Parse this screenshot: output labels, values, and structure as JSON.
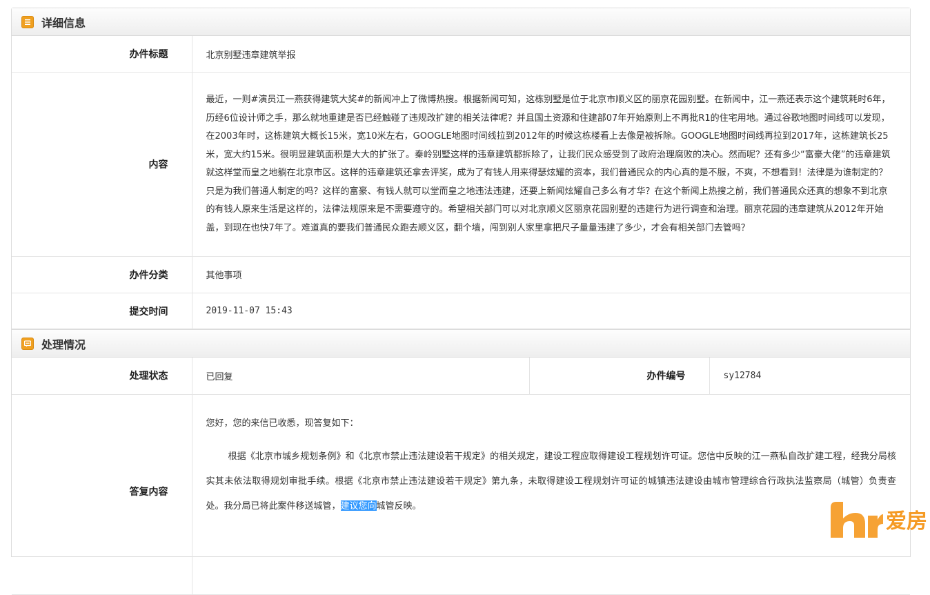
{
  "detail": {
    "header": "详细信息",
    "rows": {
      "title_label": "办件标题",
      "title_value": "北京别墅违章建筑举报",
      "content_label": "内容",
      "content_value": "最近，一则#演员江一燕获得建筑大奖#的新闻冲上了微博热搜。根据新闻可知，这栋别墅是位于北京市顺义区的丽京花园别墅。在新闻中，江一燕还表示这个建筑耗时6年，历经6位设计师之手，那么就地重建是否已经触碰了违规改扩建的相关法律呢？并且国土资源和住建部07年开始原则上不再批R1的住宅用地。通过谷歌地图时间线可以发现，在2003年时，这栋建筑大概长15米，宽10米左右，GOOGLE地图时间线拉到2012年的时候这栋楼看上去像是被拆除。GOOGLE地图时间线再拉到2017年，这栋建筑长25米，宽大约15米。很明显建筑面积是大大的扩张了。秦岭别墅这样的违章建筑都拆除了，让我们民众感受到了政府治理腐败的决心。然而呢？还有多少“富豪大佬”的违章建筑就这样堂而皇之地躺在北京市区。这样的违章建筑还拿去评奖，成为了有钱人用来得瑟炫耀的资本，我们普通民众的内心真的是不服，不爽，不想看到！法律是为谁制定的？只是为我们普通人制定的吗？这样的富豪、有钱人就可以堂而皇之地违法违建，还要上新闻炫耀自己多么有才华？在这个新闻上热搜之前，我们普通民众还真的想象不到北京的有钱人原来生活是这样的，法律法规原来是不需要遵守的。希望相关部门可以对北京顺义区丽京花园别墅的违建行为进行调查和治理。丽京花园的违章建筑从2012年开始盖，到现在也快7年了。难道真的要我们普通民众跑去顺义区，翻个墙，闯到别人家里拿把尺子量量违建了多少，才会有相关部门去管吗？",
      "category_label": "办件分类",
      "category_value": "其他事项",
      "time_label": "提交时间",
      "time_value": "2019-11-07 15:43"
    }
  },
  "processing": {
    "header": "处理情况",
    "status_label": "处理状态",
    "status_value": "已回复",
    "number_label": "办件编号",
    "number_value": "sy12784",
    "reply_label": "答复内容",
    "reply_greeting": "您好，您的来信已收悉，现答复如下：",
    "reply_body_main": "根据《北京市城乡规划条例》和《北京市禁止违法建设若干规定》的相关规定，建设工程应取得建设工程规划许可证。您信中反映的江一燕私自改扩建工程，经我分局核实其未依法取得规划审批手续。根据《北京市禁止违法建设若干规定》第九条，未取得建设工程规划许可证的城镇违法建设由城市管理综合行政执法监察局（城管）负责查处。我分局已将此案件移送城管，",
    "reply_body_selected": "建议您向",
    "reply_body_end": "城管反映。"
  },
  "watermark": {
    "text": "爱房",
    "logo_icon": "aifang-logo-icon",
    "color": "#f59a23"
  },
  "colors": {
    "header_icon": "#f0a020",
    "border": "#dcdcdc",
    "selection": "#3399ff"
  }
}
